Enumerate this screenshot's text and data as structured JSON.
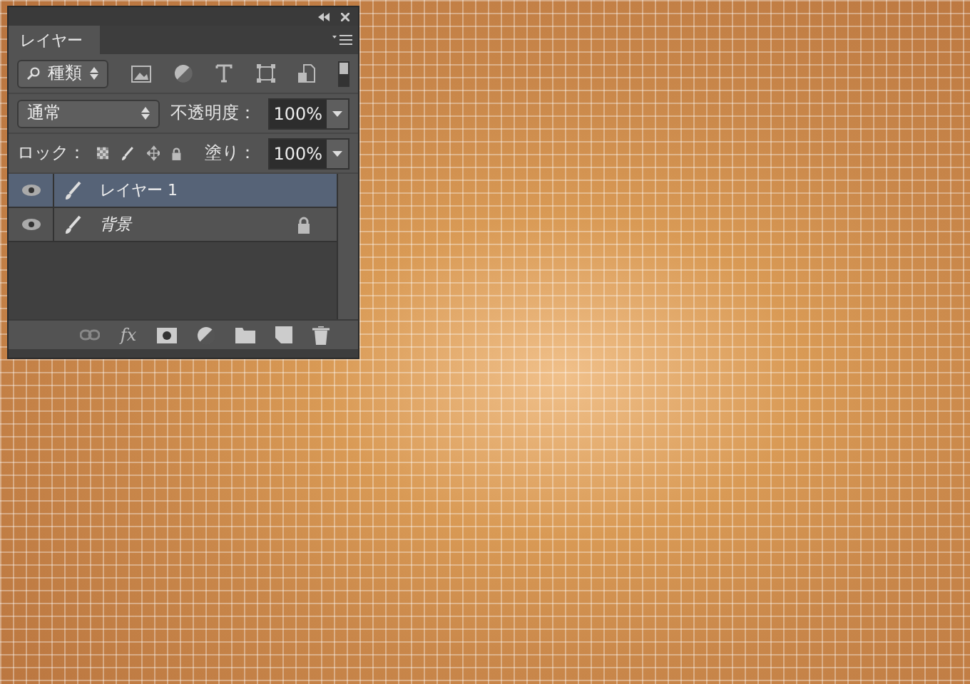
{
  "panel": {
    "tab": {
      "label": "レイヤー",
      "selected": true
    },
    "filter": {
      "value": "種類"
    },
    "blend": {
      "value": "通常"
    },
    "opacity": {
      "label": "不透明度：",
      "value": "100%"
    },
    "lock": {
      "label": "ロック："
    },
    "fill": {
      "label": "塗り：",
      "value": "100%"
    },
    "layers": [
      {
        "name": "レイヤー 1",
        "selected": true,
        "visible": true,
        "locked": false,
        "italic": false
      },
      {
        "name": "背景",
        "selected": false,
        "visible": true,
        "locked": true,
        "italic": true
      }
    ],
    "footer": {
      "fx": "fx"
    }
  }
}
